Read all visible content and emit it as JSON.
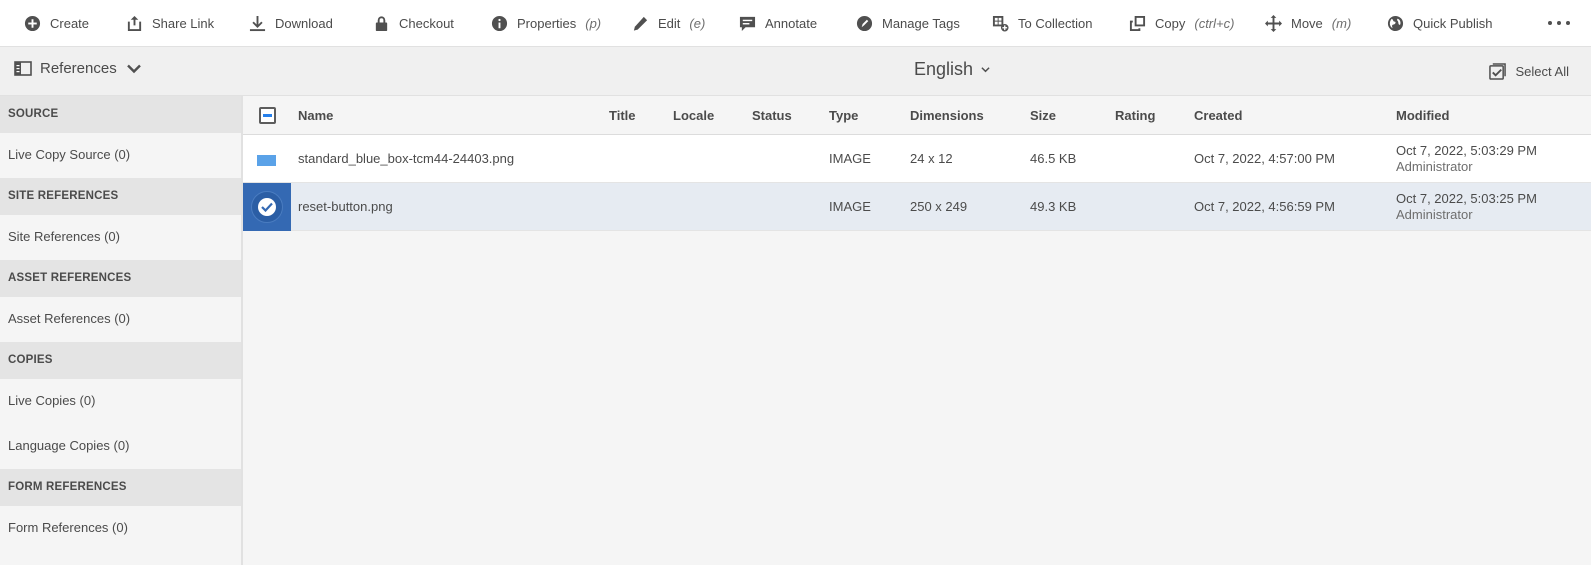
{
  "toolbar": {
    "actions": [
      {
        "label": "Create",
        "shortcut": "",
        "icon": "plus-circle-icon"
      },
      {
        "label": "Share Link",
        "shortcut": "",
        "icon": "share-icon"
      },
      {
        "label": "Download",
        "shortcut": "",
        "icon": "download-icon"
      },
      {
        "label": "Checkout",
        "shortcut": "",
        "icon": "lock-icon"
      },
      {
        "label": "Properties",
        "shortcut": "(p)",
        "icon": "info-icon"
      },
      {
        "label": "Edit",
        "shortcut": "(e)",
        "icon": "pencil-icon"
      },
      {
        "label": "Annotate",
        "shortcut": "",
        "icon": "comment-icon"
      },
      {
        "label": "Manage Tags",
        "shortcut": "",
        "icon": "tag-icon"
      },
      {
        "label": "To Collection",
        "shortcut": "",
        "icon": "collection-add-icon"
      },
      {
        "label": "Copy",
        "shortcut": "(ctrl+c)",
        "icon": "copy-icon"
      },
      {
        "label": "Move",
        "shortcut": "(m)",
        "icon": "move-icon"
      },
      {
        "label": "Quick Publish",
        "shortcut": "",
        "icon": "globe-icon"
      }
    ],
    "more_icon": "more-icon"
  },
  "subbar": {
    "rail_label": "References",
    "language": "English",
    "select_all": "Select All"
  },
  "rail": {
    "sections": [
      {
        "title": "SOURCE",
        "items": [
          "Live Copy Source (0)"
        ]
      },
      {
        "title": "SITE REFERENCES",
        "items": [
          "Site References (0)"
        ]
      },
      {
        "title": "ASSET REFERENCES",
        "items": [
          "Asset References (0)"
        ]
      },
      {
        "title": "COPIES",
        "items": [
          "Live Copies (0)",
          "Language Copies (0)"
        ]
      },
      {
        "title": "FORM REFERENCES",
        "items": [
          "Form References (0)"
        ]
      }
    ]
  },
  "table": {
    "columns": [
      "Name",
      "Title",
      "Locale",
      "Status",
      "Type",
      "Dimensions",
      "Size",
      "Rating",
      "Created",
      "Modified"
    ],
    "rows": [
      {
        "name": "standard_blue_box-tcm44-24403.png",
        "title": "",
        "locale": "",
        "status": "",
        "type": "IMAGE",
        "dimensions": "24 x 12",
        "size": "46.5 KB",
        "rating": "",
        "created": "Oct 7, 2022, 4:57:00 PM",
        "modified": "Oct 7, 2022, 5:03:29 PM",
        "modified_by": "Administrator",
        "selected": false
      },
      {
        "name": "reset-button.png",
        "title": "",
        "locale": "",
        "status": "",
        "type": "IMAGE",
        "dimensions": "250 x 249",
        "size": "49.3 KB",
        "rating": "",
        "created": "Oct 7, 2022, 4:56:59 PM",
        "modified": "Oct 7, 2022, 5:03:25 PM",
        "modified_by": "Administrator",
        "selected": true
      }
    ]
  },
  "colors": {
    "selection": "#3469b3",
    "thumbnail_blue": "#5aa2e8",
    "selected_row": "#e6ebf2"
  }
}
